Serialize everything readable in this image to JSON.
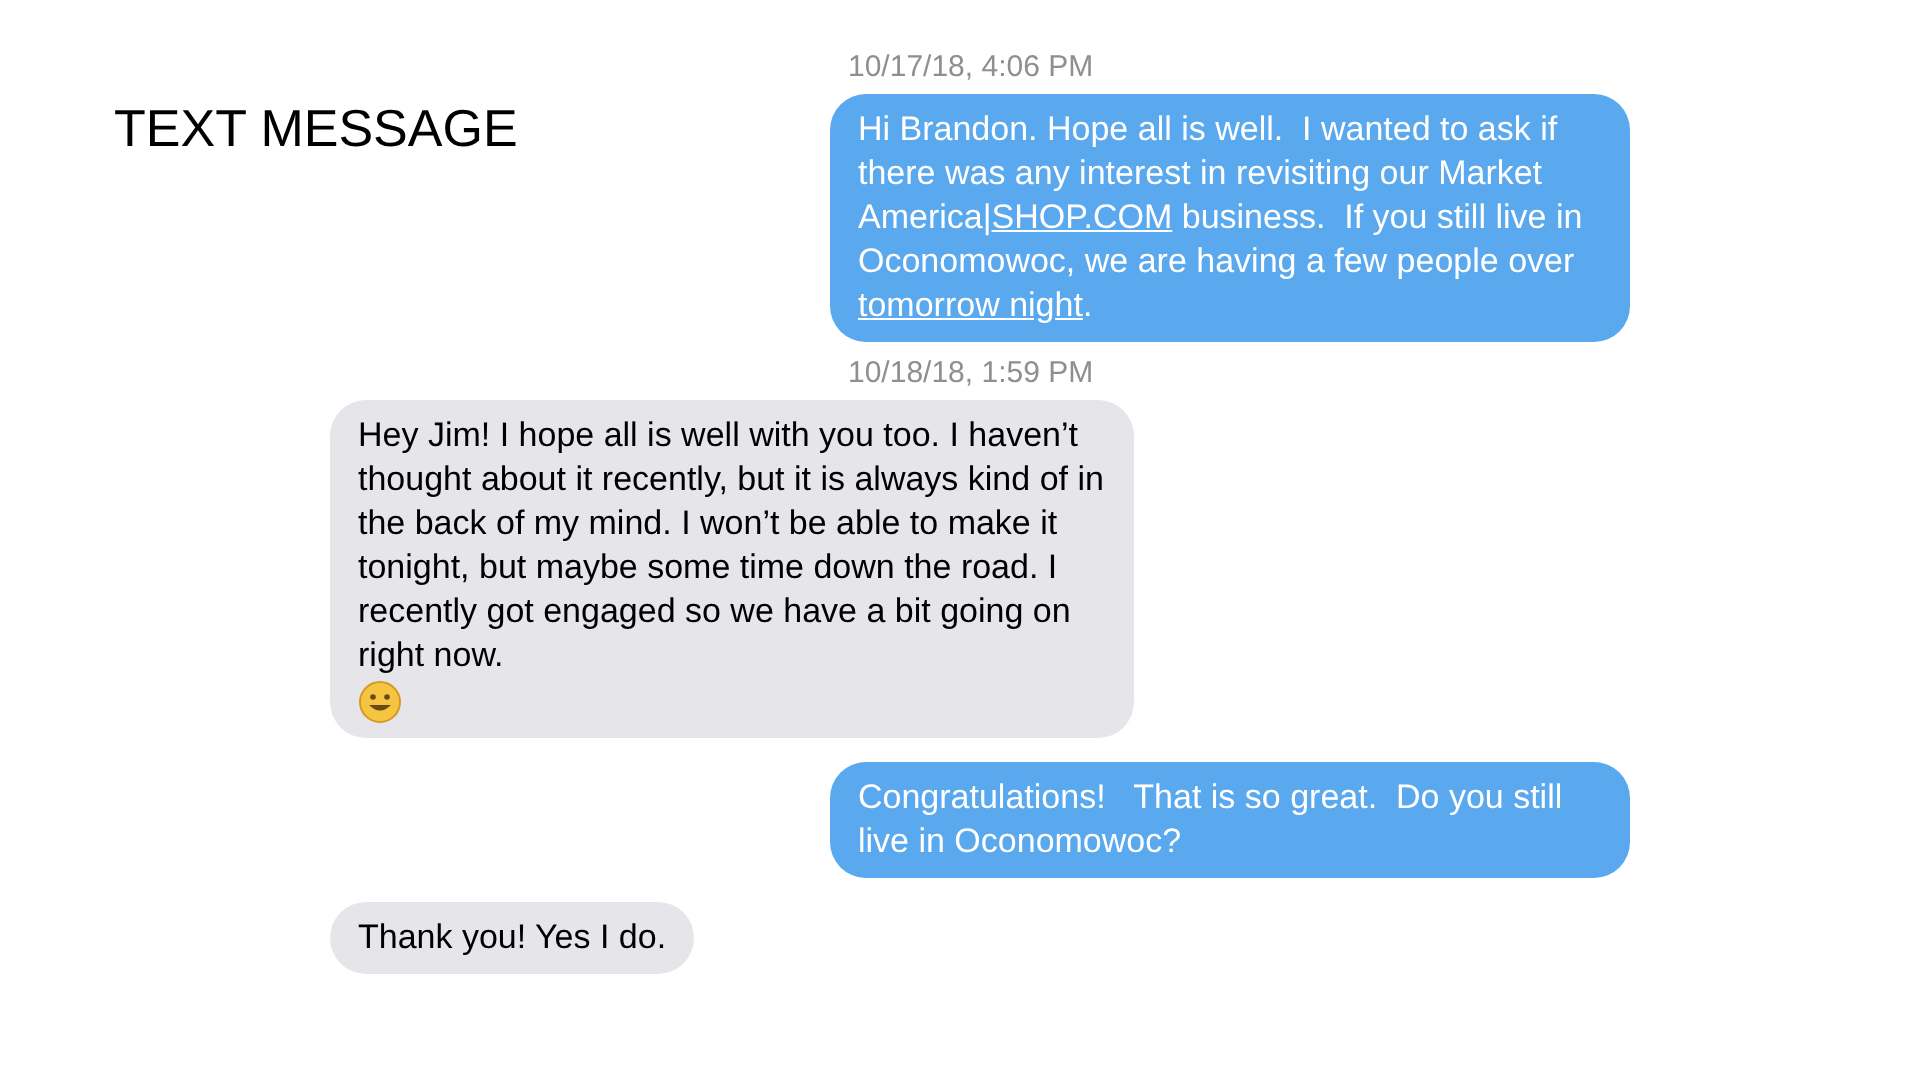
{
  "slide_title": "TEXT MESSAGE",
  "messages": [
    {
      "timestamp": "10/17/18, 4:06 PM",
      "kind": "sent",
      "segments": [
        {
          "kind": "text",
          "text": "Hi Brandon. Hope all is well.  I wanted to ask if there was any interest in revisiting our Market America|"
        },
        {
          "kind": "link",
          "text": "SHOP.COM"
        },
        {
          "kind": "text",
          "text": " business.  If you still live in Oconomowoc, we are having a few people over "
        },
        {
          "kind": "link",
          "text": "tomorrow night"
        },
        {
          "kind": "text",
          "text": "."
        }
      ]
    },
    {
      "timestamp": "10/18/18, 1:59 PM",
      "kind": "received",
      "segments": [
        {
          "kind": "text",
          "text": "Hey Jim! I hope all is well with you too. I haven’t thought about it recently, but it is always kind of in the back of my mind. I won’t be able to make it tonight, but maybe some time down the road. I recently got engaged so we have a bit going on right now."
        },
        {
          "kind": "emoji"
        }
      ]
    },
    {
      "kind": "sent",
      "segments": [
        {
          "kind": "text",
          "text": "Congratulations!   That is so great.  Do you still live in Oconomowoc?"
        }
      ]
    },
    {
      "kind": "received",
      "segments": [
        {
          "kind": "text",
          "text": "Thank you! Yes I do."
        }
      ]
    }
  ]
}
